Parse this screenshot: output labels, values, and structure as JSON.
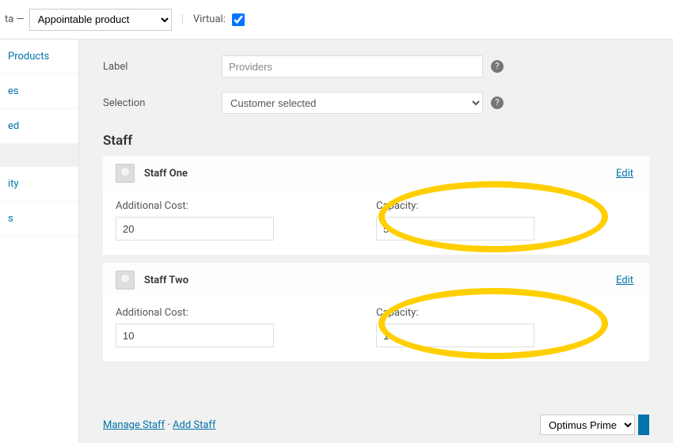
{
  "topbar": {
    "product_data_suffix": "ta —",
    "product_type": "Appointable product",
    "virtual_label": "Virtual:",
    "virtual_checked": true
  },
  "sidebar": {
    "items": [
      "Products",
      "es",
      "ed",
      "",
      "ity",
      "s"
    ]
  },
  "form": {
    "label_field": {
      "label": "Label",
      "value": "Providers"
    },
    "selection_field": {
      "label": "Selection",
      "value": "Customer selected"
    }
  },
  "staff": {
    "heading": "Staff",
    "edit_label": "Edit",
    "cost_label": "Additional Cost:",
    "capacity_label": "Capacity:",
    "members": [
      {
        "name": "Staff One",
        "additional_cost": "20",
        "capacity": "5"
      },
      {
        "name": "Staff Two",
        "additional_cost": "10",
        "capacity": "1"
      }
    ]
  },
  "footer": {
    "manage_label": "Manage Staff",
    "add_label": "Add Staff",
    "dropdown_value": "Optimus Prime"
  }
}
